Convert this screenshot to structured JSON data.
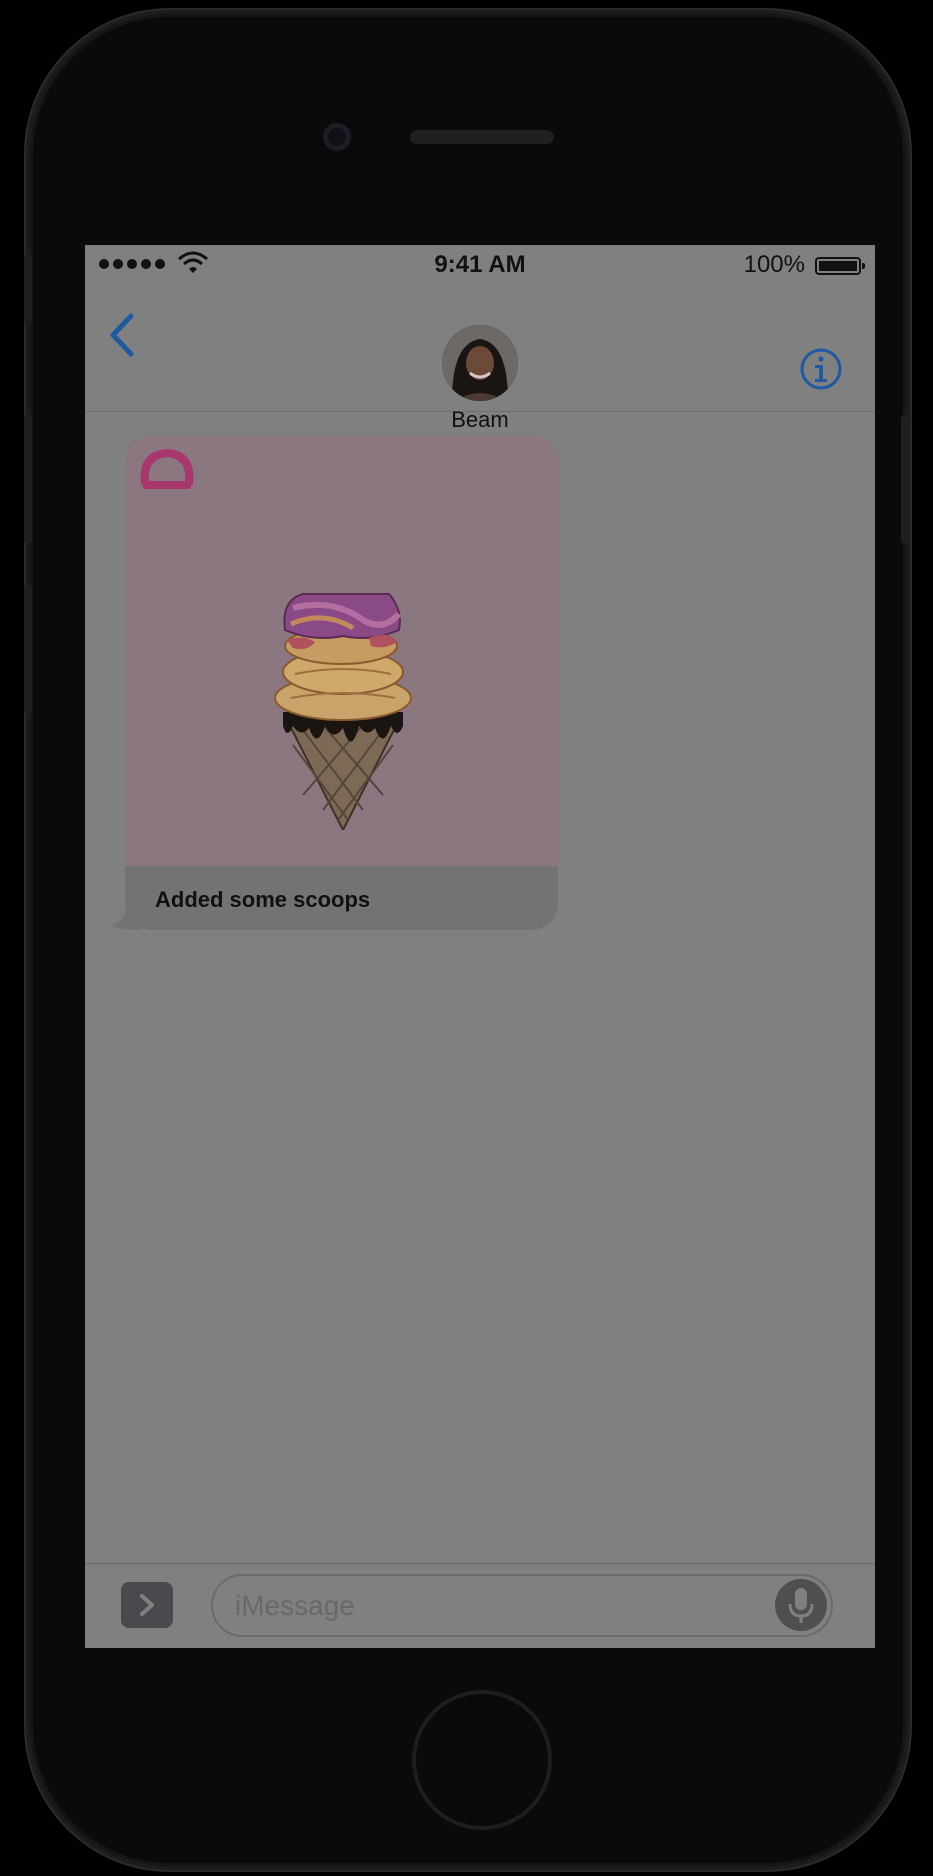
{
  "status_bar": {
    "time": "9:41 AM",
    "battery_percent": "100%",
    "battery_level": 1.0,
    "signal_bars": 5,
    "icons": [
      "signal-dots-icon",
      "wifi-icon",
      "battery-icon"
    ]
  },
  "nav": {
    "contact_name": "Beam",
    "icons": [
      "chevron-left-icon",
      "info-icon"
    ]
  },
  "message": {
    "caption": "Added some scoops",
    "app_icon": "ice-cream-app-icon",
    "image": "ice-cream-cone"
  },
  "input": {
    "placeholder": "iMessage",
    "icons": [
      "chevron-right-icon",
      "microphone-icon"
    ]
  },
  "colors": {
    "accent": "#1d5aa0",
    "app_brand": "#a8376e",
    "bubble_bg": "#737373",
    "screen_dimmed": "#808080"
  }
}
